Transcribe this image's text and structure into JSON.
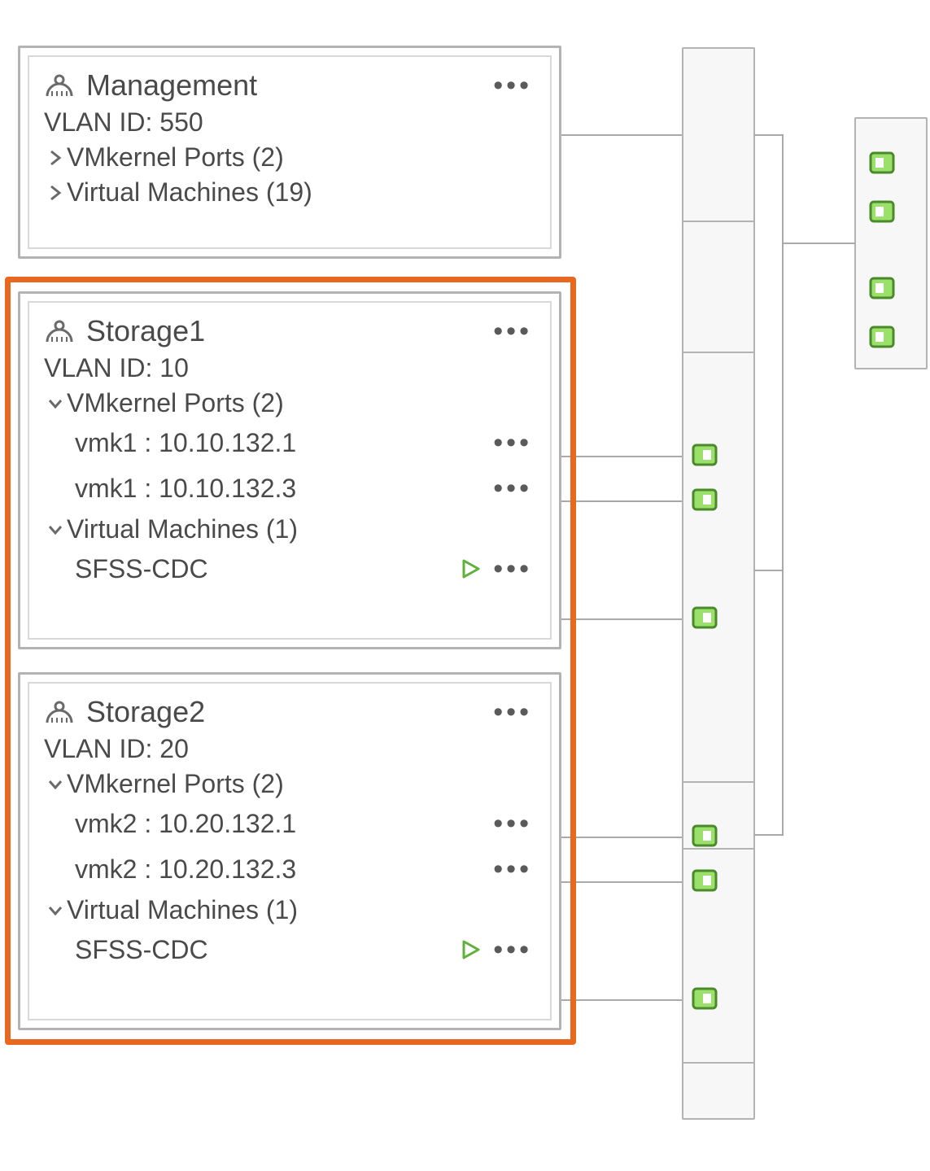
{
  "labels": {
    "vlan_prefix": "VLAN ID: ",
    "vmk_section_prefix": "VMkernel Ports (",
    "vmk_section_suffix": ")",
    "vm_section_prefix": "Virtual Machines (",
    "vm_section_suffix": ")"
  },
  "port_groups": [
    {
      "name": "Management",
      "vlan": "550",
      "vmk_count": "2",
      "vm_count": "19",
      "expanded": false,
      "vmk_items": [],
      "vm_items": []
    },
    {
      "name": "Storage1",
      "vlan": "10",
      "vmk_count": "2",
      "vm_count": "1",
      "expanded": true,
      "vmk_items": [
        {
          "label": "vmk1 : 10.10.132.1"
        },
        {
          "label": "vmk1 : 10.10.132.3"
        }
      ],
      "vm_items": [
        {
          "label": "SFSS-CDC"
        }
      ]
    },
    {
      "name": "Storage2",
      "vlan": "20",
      "vmk_count": "2",
      "vm_count": "1",
      "expanded": true,
      "vmk_items": [
        {
          "label": "vmk2 : 10.20.132.1"
        },
        {
          "label": "vmk2 : 10.20.132.3"
        }
      ],
      "vm_items": [
        {
          "label": "SFSS-CDC"
        }
      ]
    }
  ]
}
